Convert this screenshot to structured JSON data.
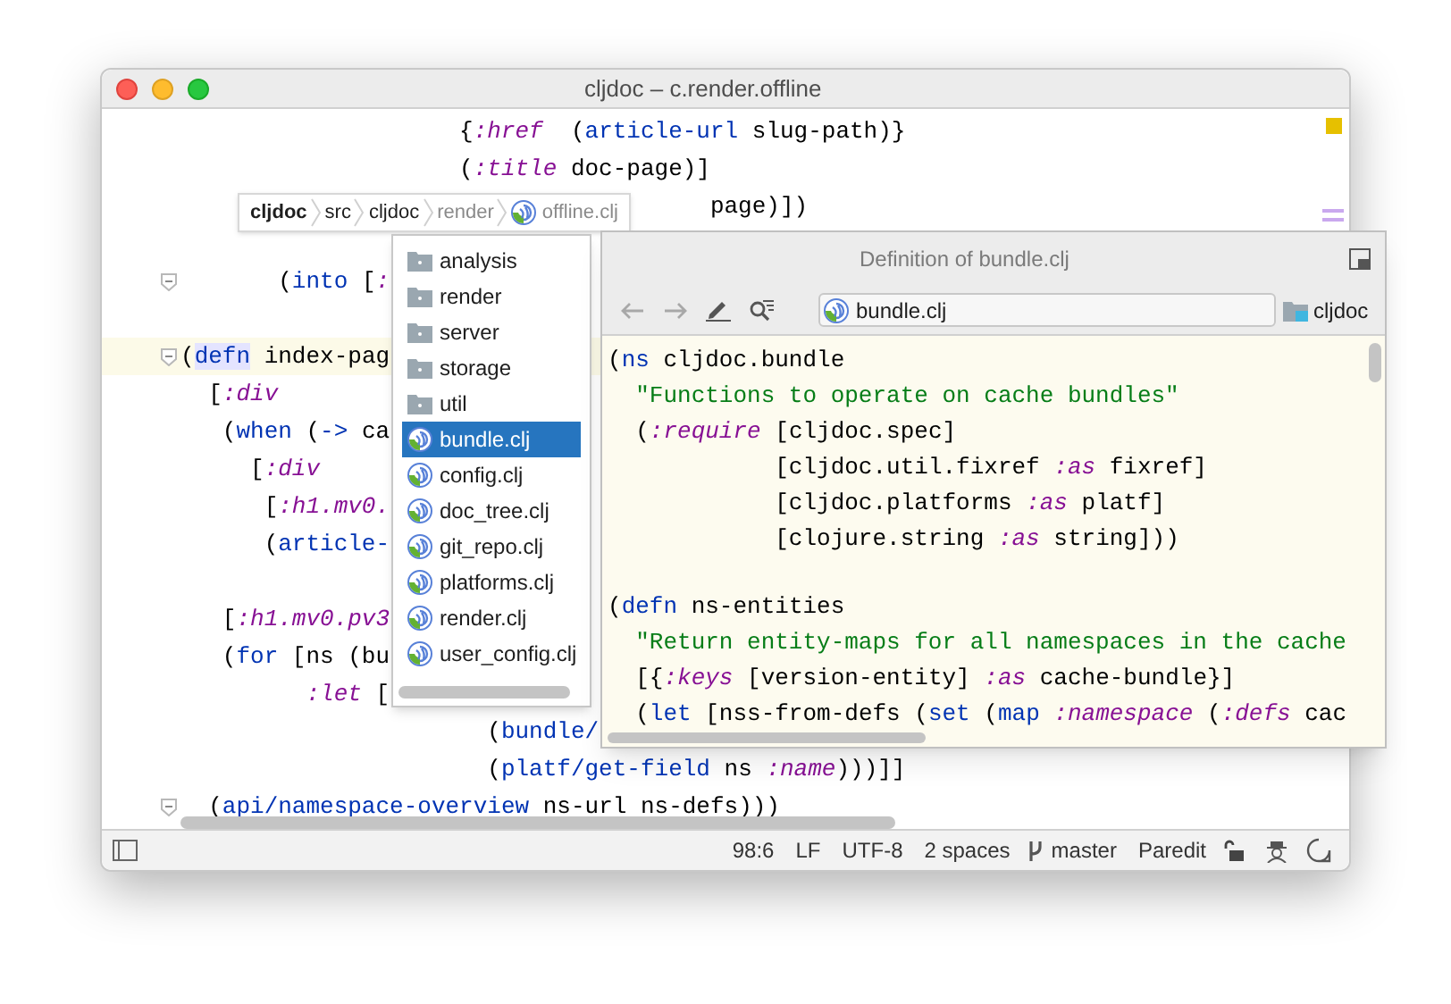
{
  "window": {
    "title": "cljdoc – c.render.offline"
  },
  "editor": {
    "lines": [
      {
        "kind": "code",
        "tokens": [
          {
            "text": "                    {",
            "kind": "plain"
          },
          {
            "text": ":href",
            "kind": "keyword"
          },
          {
            "text": "  (",
            "kind": "plain"
          },
          {
            "text": "article-url",
            "kind": "special"
          },
          {
            "text": " slug-path)}",
            "kind": "plain"
          }
        ]
      },
      {
        "kind": "code",
        "tokens": [
          {
            "text": "                    (",
            "kind": "plain"
          },
          {
            "text": ":title",
            "kind": "keyword"
          },
          {
            "text": " doc-page)]",
            "kind": "plain"
          }
        ]
      },
      {
        "kind": "code",
        "tokens": [
          {
            "text": "                                      page)])",
            "kind": "plain"
          }
        ]
      },
      {
        "kind": "blank"
      },
      {
        "kind": "code",
        "fold": true,
        "tokens": [
          {
            "text": "       (",
            "kind": "plain"
          },
          {
            "text": "into",
            "kind": "special"
          },
          {
            "text": " [",
            "kind": "plain"
          },
          {
            "text": ":",
            "kind": "keyword"
          }
        ]
      },
      {
        "kind": "blank"
      },
      {
        "kind": "code",
        "fold": true,
        "current": true,
        "tokens": [
          {
            "text": "(",
            "kind": "plain"
          },
          {
            "text": "defn",
            "kind": "special",
            "marked": true
          },
          {
            "text": " index-pag",
            "kind": "plain"
          }
        ]
      },
      {
        "kind": "code",
        "tokens": [
          {
            "text": "  [",
            "kind": "plain"
          },
          {
            "text": ":div",
            "kind": "keyword"
          }
        ]
      },
      {
        "kind": "code",
        "tokens": [
          {
            "text": "   (",
            "kind": "plain"
          },
          {
            "text": "when",
            "kind": "special"
          },
          {
            "text": " (",
            "kind": "plain"
          },
          {
            "text": "->",
            "kind": "special"
          },
          {
            "text": " ca",
            "kind": "plain"
          }
        ]
      },
      {
        "kind": "code",
        "tokens": [
          {
            "text": "     [",
            "kind": "plain"
          },
          {
            "text": ":div",
            "kind": "keyword"
          }
        ]
      },
      {
        "kind": "code",
        "tokens": [
          {
            "text": "      [",
            "kind": "plain"
          },
          {
            "text": ":h1.mv0.",
            "kind": "keyword"
          }
        ]
      },
      {
        "kind": "code",
        "tokens": [
          {
            "text": "      (",
            "kind": "plain"
          },
          {
            "text": "article-",
            "kind": "special"
          }
        ]
      },
      {
        "kind": "blank"
      },
      {
        "kind": "code",
        "tokens": [
          {
            "text": "   [",
            "kind": "plain"
          },
          {
            "text": ":h1.mv0.pv3",
            "kind": "keyword"
          }
        ]
      },
      {
        "kind": "code",
        "tokens": [
          {
            "text": "   (",
            "kind": "plain"
          },
          {
            "text": "for",
            "kind": "special"
          },
          {
            "text": " [ns (bu",
            "kind": "plain"
          }
        ]
      },
      {
        "kind": "code",
        "tokens": [
          {
            "text": "         :let",
            "kind": "keyword"
          },
          {
            "text": " [",
            "kind": "plain"
          }
        ]
      },
      {
        "kind": "code",
        "tokens": [
          {
            "text": "                      (",
            "kind": "plain"
          },
          {
            "text": "bundle/",
            "kind": "special"
          }
        ]
      },
      {
        "kind": "code",
        "tokens": [
          {
            "text": "                      (",
            "kind": "plain"
          },
          {
            "text": "platf/get-field",
            "kind": "special"
          },
          {
            "text": " ns ",
            "kind": "plain"
          },
          {
            "text": ":name",
            "kind": "keyword"
          },
          {
            "text": ")))]]",
            "kind": "plain"
          }
        ]
      },
      {
        "kind": "code",
        "fold": true,
        "tokens": [
          {
            "text": "  (",
            "kind": "plain"
          },
          {
            "text": "api/namespace-overview",
            "kind": "special"
          },
          {
            "text": " ns-url ns-defs)))",
            "kind": "plain"
          }
        ]
      }
    ]
  },
  "breadcrumb": [
    {
      "label": "cljdoc",
      "kind": "project",
      "dimmed": false
    },
    {
      "label": "src",
      "kind": "folder",
      "dimmed": false
    },
    {
      "label": "cljdoc",
      "kind": "folder",
      "dimmed": false
    },
    {
      "label": "render",
      "kind": "folder",
      "dimmed": true
    },
    {
      "label": "offline.clj",
      "kind": "file",
      "dimmed": true
    }
  ],
  "dropdown": [
    {
      "label": "analysis",
      "kind": "folder",
      "selected": false
    },
    {
      "label": "render",
      "kind": "folder",
      "selected": false
    },
    {
      "label": "server",
      "kind": "folder",
      "selected": false
    },
    {
      "label": "storage",
      "kind": "folder",
      "selected": false
    },
    {
      "label": "util",
      "kind": "folder",
      "selected": false
    },
    {
      "label": "bundle.clj",
      "kind": "file",
      "selected": true
    },
    {
      "label": "config.clj",
      "kind": "file",
      "selected": false
    },
    {
      "label": "doc_tree.clj",
      "kind": "file",
      "selected": false
    },
    {
      "label": "git_repo.clj",
      "kind": "file",
      "selected": false
    },
    {
      "label": "platforms.clj",
      "kind": "file",
      "selected": false
    },
    {
      "label": "render.clj",
      "kind": "file",
      "selected": false
    },
    {
      "label": "user_config.clj",
      "kind": "file",
      "selected": false
    }
  ],
  "popup": {
    "title": "Definition of bundle.clj",
    "file": "bundle.clj",
    "module": "cljdoc",
    "lines": [
      {
        "kind": "code",
        "tokens": [
          {
            "text": "(",
            "kind": "plain"
          },
          {
            "text": "ns",
            "kind": "special"
          },
          {
            "text": " cljdoc.bundle",
            "kind": "plain"
          }
        ]
      },
      {
        "kind": "code",
        "tokens": [
          {
            "text": "  \"Functions to operate on cache bundles\"",
            "kind": "string"
          }
        ]
      },
      {
        "kind": "code",
        "tokens": [
          {
            "text": "  (",
            "kind": "plain"
          },
          {
            "text": ":require",
            "kind": "keyword"
          },
          {
            "text": " [cljdoc.spec]",
            "kind": "plain"
          }
        ]
      },
      {
        "kind": "code",
        "tokens": [
          {
            "text": "            [cljdoc.util.fixref ",
            "kind": "plain"
          },
          {
            "text": ":as",
            "kind": "keyword"
          },
          {
            "text": " fixref]",
            "kind": "plain"
          }
        ]
      },
      {
        "kind": "code",
        "tokens": [
          {
            "text": "            [cljdoc.platforms ",
            "kind": "plain"
          },
          {
            "text": ":as",
            "kind": "keyword"
          },
          {
            "text": " platf]",
            "kind": "plain"
          }
        ]
      },
      {
        "kind": "code",
        "tokens": [
          {
            "text": "            [clojure.string ",
            "kind": "plain"
          },
          {
            "text": ":as",
            "kind": "keyword"
          },
          {
            "text": " string]))",
            "kind": "plain"
          }
        ]
      },
      {
        "kind": "blank"
      },
      {
        "kind": "code",
        "tokens": [
          {
            "text": "(",
            "kind": "plain"
          },
          {
            "text": "defn",
            "kind": "special"
          },
          {
            "text": " ns-entities",
            "kind": "plain"
          }
        ]
      },
      {
        "kind": "code",
        "tokens": [
          {
            "text": "  \"Return entity-maps for all namespaces in the cache",
            "kind": "string"
          }
        ]
      },
      {
        "kind": "code",
        "tokens": [
          {
            "text": "  [{",
            "kind": "plain"
          },
          {
            "text": ":keys",
            "kind": "keyword"
          },
          {
            "text": " [version-entity] ",
            "kind": "plain"
          },
          {
            "text": ":as",
            "kind": "keyword"
          },
          {
            "text": " cache-bundle}]",
            "kind": "plain"
          }
        ]
      },
      {
        "kind": "code",
        "tokens": [
          {
            "text": "  (",
            "kind": "plain"
          },
          {
            "text": "let",
            "kind": "special"
          },
          {
            "text": " [nss-from-defs (",
            "kind": "plain"
          },
          {
            "text": "set",
            "kind": "special"
          },
          {
            "text": " (",
            "kind": "plain"
          },
          {
            "text": "map",
            "kind": "special"
          },
          {
            "text": " :namespace",
            "kind": "keyword"
          },
          {
            "text": " (",
            "kind": "plain"
          },
          {
            "text": ":defs",
            "kind": "keyword"
          },
          {
            "text": " cac",
            "kind": "plain"
          }
        ]
      }
    ]
  },
  "status_bar": {
    "position": "98:6",
    "line_ending": "LF",
    "encoding": "UTF-8",
    "indent": "2 spaces",
    "branch": "master",
    "mode": "Paredit"
  }
}
